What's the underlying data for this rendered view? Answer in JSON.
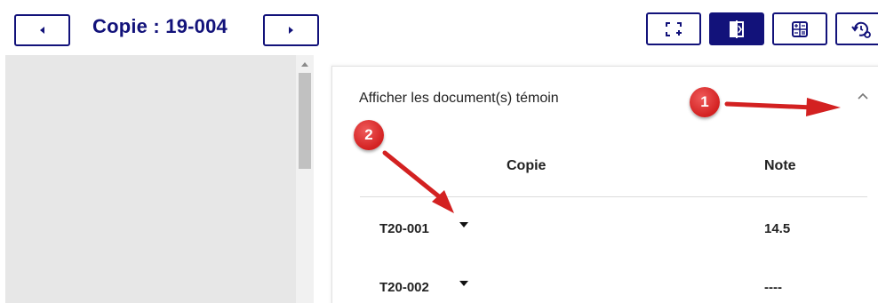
{
  "toolbar": {
    "title": "Copie : 19-004",
    "prev_icon": "chevron-left-icon",
    "next_icon": "chevron-right-icon",
    "tools": [
      {
        "icon": "expand-add-icon",
        "active": false
      },
      {
        "icon": "split-view-icon",
        "active": true
      },
      {
        "icon": "calculator-icon",
        "active": false
      },
      {
        "icon": "history-settings-icon",
        "active": false
      }
    ]
  },
  "panel": {
    "title": "Afficher les document(s) témoin",
    "columns": [
      "Copie",
      "Note"
    ],
    "rows": [
      {
        "copie": "T20-001",
        "note": "14.5"
      },
      {
        "copie": "T20-002",
        "note": "----"
      }
    ]
  },
  "annotations": {
    "badge1": "1",
    "badge2": "2",
    "color": "#d32121"
  },
  "colors": {
    "primary": "#12127a",
    "left_pane": "#e7e7e7"
  }
}
